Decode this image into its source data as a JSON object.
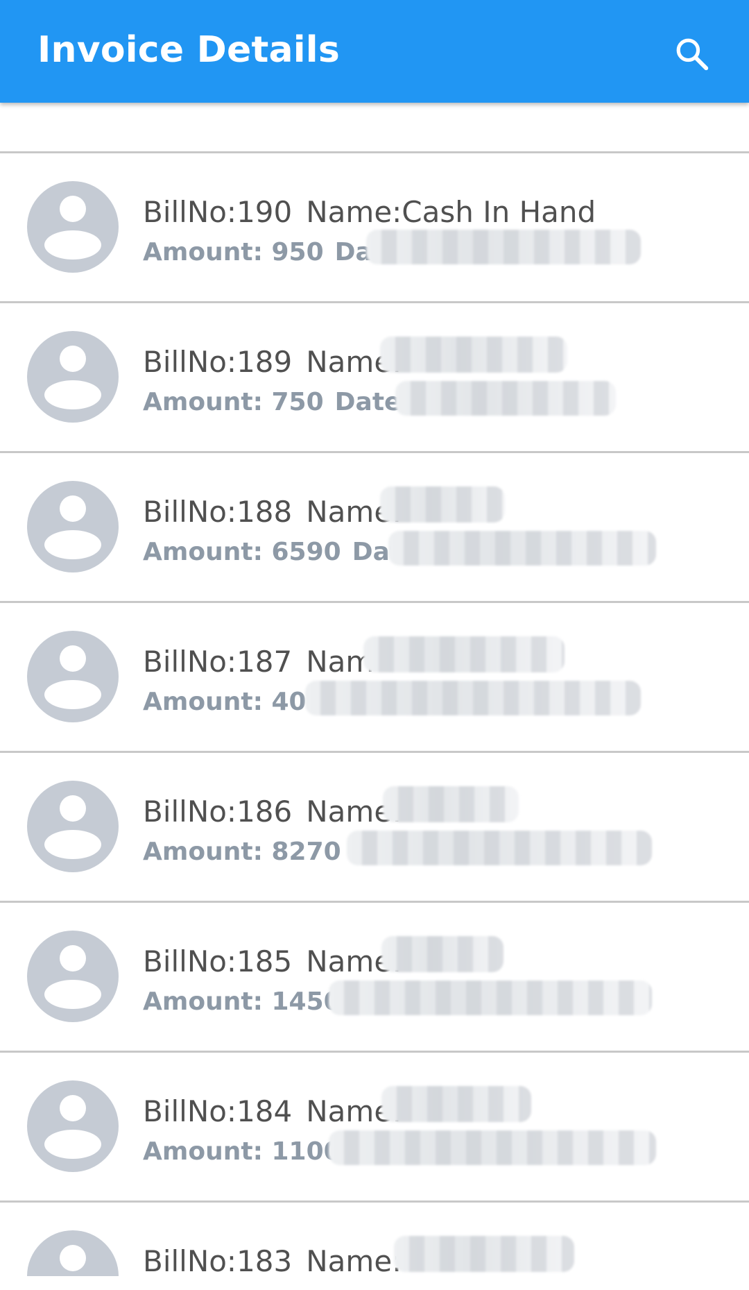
{
  "appbar": {
    "title": "Invoice Details",
    "search_icon": "search-icon",
    "color": "#2196F3"
  },
  "invoices": [
    {
      "bill": "BillNo:190",
      "name": "Name:Cash In Hand",
      "amount": "Amount: 950",
      "date": "Date:"
    },
    {
      "bill": "BillNo:189",
      "name": "Name:",
      "amount": "Amount: 750",
      "date": "Date:"
    },
    {
      "bill": "BillNo:188",
      "name": "Name:",
      "amount": "Amount: 6590",
      "date": "Date:"
    },
    {
      "bill": "BillNo:187",
      "name": "Nam",
      "amount": "Amount: 400",
      "date": ""
    },
    {
      "bill": "BillNo:186",
      "name": "Name:",
      "amount": "Amount: 8270",
      "date": "Da"
    },
    {
      "bill": "BillNo:185",
      "name": "Name:",
      "amount": "Amount: 1450",
      "date": ""
    },
    {
      "bill": "BillNo:184",
      "name": "Name:",
      "amount": "Amount: 1100",
      "date": ""
    },
    {
      "bill": "BillNo:183",
      "name": "Name:",
      "amount": "",
      "date": ""
    }
  ],
  "colors": {
    "avatar": "#C5CBD4",
    "divider": "#c8c8c8",
    "primary_text": "#505050",
    "secondary_text": "#8d99a6"
  }
}
